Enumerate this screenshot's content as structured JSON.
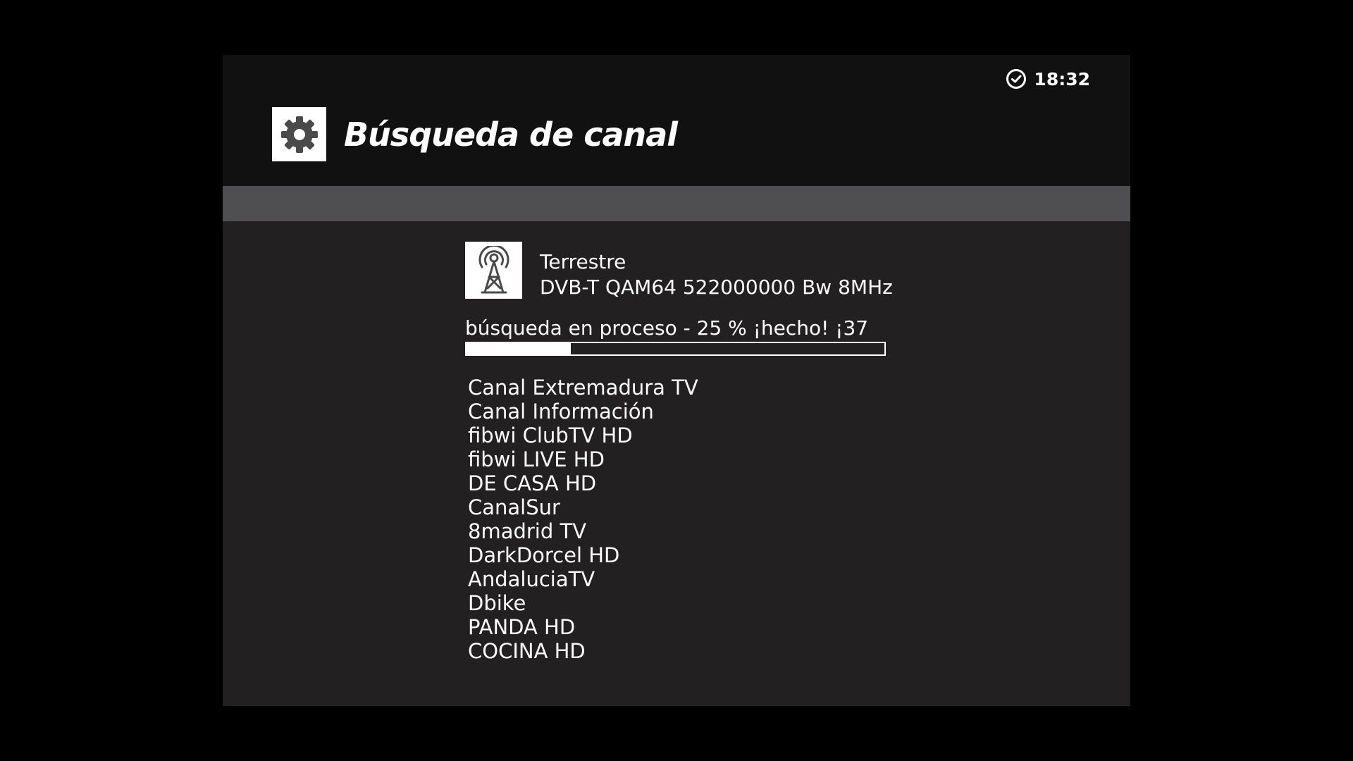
{
  "header": {
    "title": "Búsqueda de canal",
    "time": "18:32",
    "clock_icon": "clock-icon",
    "title_icon": "gear-icon"
  },
  "signal": {
    "icon": "antenna-tower-icon",
    "type": "Terrestre",
    "params": "DVB-T QAM64 522000000 Bw 8MHz"
  },
  "progress": {
    "text": "búsqueda en proceso - 25 % ¡hecho! ¡37",
    "percent": 25
  },
  "channels": [
    "Canal Extremadura TV",
    "Canal Información",
    "fibwi ClubTV HD",
    "fibwi LIVE HD",
    "DE CASA HD",
    "CanalSur",
    "8madrid TV",
    "DarkDorcel HD",
    "AndaluciaTV",
    "Dbike",
    "PANDA HD",
    "COCINA HD"
  ],
  "colors": {
    "background": "#000000",
    "panel": "#222021",
    "header": "#111111",
    "subbar": "#4f4f51",
    "text": "#ffffff"
  }
}
